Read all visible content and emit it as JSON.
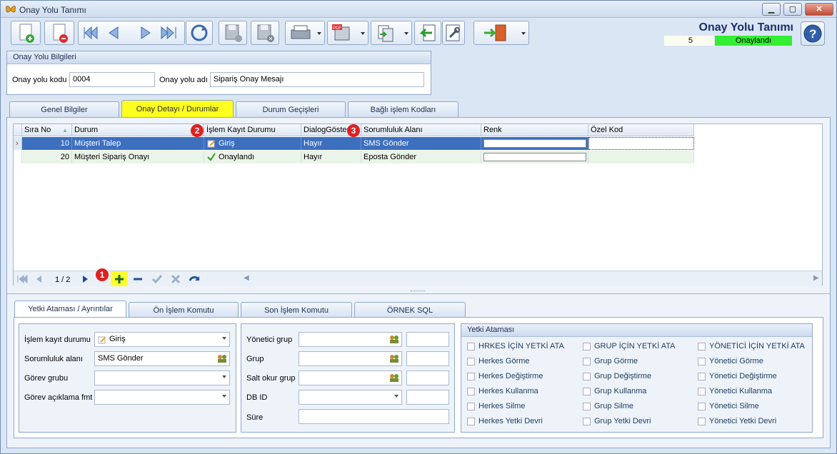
{
  "window": {
    "title": "Onay Yolu Tanımı"
  },
  "header": {
    "title": "Onay Yolu Tanımı",
    "record_no": "5",
    "status": "Onaylandı"
  },
  "info_group": {
    "title": "Onay Yolu Bilgileri",
    "code_label": "Onay yolu kodu",
    "code_value": "0004",
    "name_label": "Onay yolu adı",
    "name_value": "Sipariş Onay Mesajı"
  },
  "main_tabs": [
    "Genel Bilgiler",
    "Onay Detayı / Durumlar",
    "Durum Geçişleri",
    "Bağlı işlem Kodları"
  ],
  "grid": {
    "columns": [
      "Sıra No",
      "Durum",
      "İşlem Kayıt Durumu",
      "DialogGöster",
      "Sorumluluk Alanı",
      "Renk",
      "Özel Kod"
    ],
    "rows": [
      {
        "sira": "10",
        "durum": "Müşteri Talep",
        "islem": "Giriş",
        "dialog": "Hayır",
        "sorumluluk": "SMS Gönder"
      },
      {
        "sira": "20",
        "durum": "Müşteri Sipariş Onayı",
        "islem": "Onaylandı",
        "dialog": "Hayır",
        "sorumluluk": "Eposta Gönder"
      }
    ],
    "pager": "1 / 2"
  },
  "badges": [
    "1",
    "2",
    "3"
  ],
  "detail_tabs": [
    "Yetki Ataması / Ayrıntılar",
    "Ön İşlem Komutu",
    "Son İşlem Komutu",
    "ÖRNEK SQL"
  ],
  "left_form": {
    "islem_label": "İşlem kayıt durumu",
    "islem_value": "Giriş",
    "sorumluluk_label": "Sorumluluk alanı",
    "sorumluluk_value": "SMS Gönder",
    "gorev_label": "Görev grubu",
    "aciklama_label": "Görev açıklama fmt"
  },
  "mid_form": {
    "yonetici_label": "Yönetici grup",
    "grup_label": "Grup",
    "saltokur_label": "Salt okur grup",
    "dbid_label": "DB ID",
    "sure_label": "Süre"
  },
  "yetki": {
    "title": "Yetki Ataması",
    "col1": [
      "HRKES İÇİN YETKİ ATA",
      "Herkes Görme",
      "Herkes Değiştirme",
      "Herkes Kullanma",
      "Herkes Silme",
      "Herkes Yetki Devri"
    ],
    "col2": [
      "GRUP İÇİN YETKİ ATA",
      "Grup Görme",
      "Grup Değiştirme",
      "Grup Kullanma",
      "Grup Silme",
      "Grup Yetki Devri"
    ],
    "col3": [
      "YÖNETİCİ İÇİN YETKİ ATA",
      "Yönetici Görme",
      "Yönetici Değiştirme",
      "Yönetici Kullanma",
      "Yönetici Silme",
      "Yönetici Yetki Devri"
    ]
  }
}
